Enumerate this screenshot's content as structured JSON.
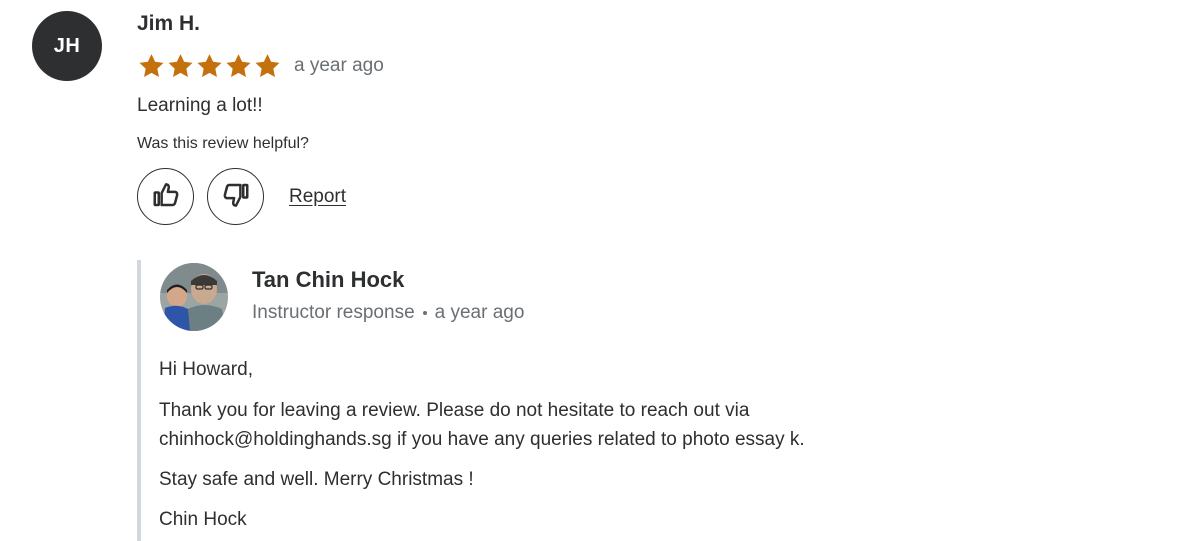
{
  "review": {
    "avatar_initials": "JH",
    "reviewer_name": "Jim H.",
    "rating": 5,
    "rating_max": 5,
    "star_color": "#c4710d",
    "date": "a year ago",
    "text": "Learning a lot!!",
    "helpful_label": "Was this review helpful?",
    "report_label": "Report",
    "thumbs_up_icon": "thumbs-up-icon",
    "thumbs_down_icon": "thumbs-down-icon"
  },
  "response": {
    "instructor_name": "Tan Chin Hock",
    "role_label": "Instructor response",
    "date": "a year ago",
    "paragraphs": [
      "Hi Howard,",
      "Thank you for leaving a review. Please do not hesitate to reach out via",
      "chinhock@holdinghands.sg if you have any queries related to photo essay k.",
      "Stay safe and well. Merry Christmas !",
      "Chin Hock"
    ]
  }
}
